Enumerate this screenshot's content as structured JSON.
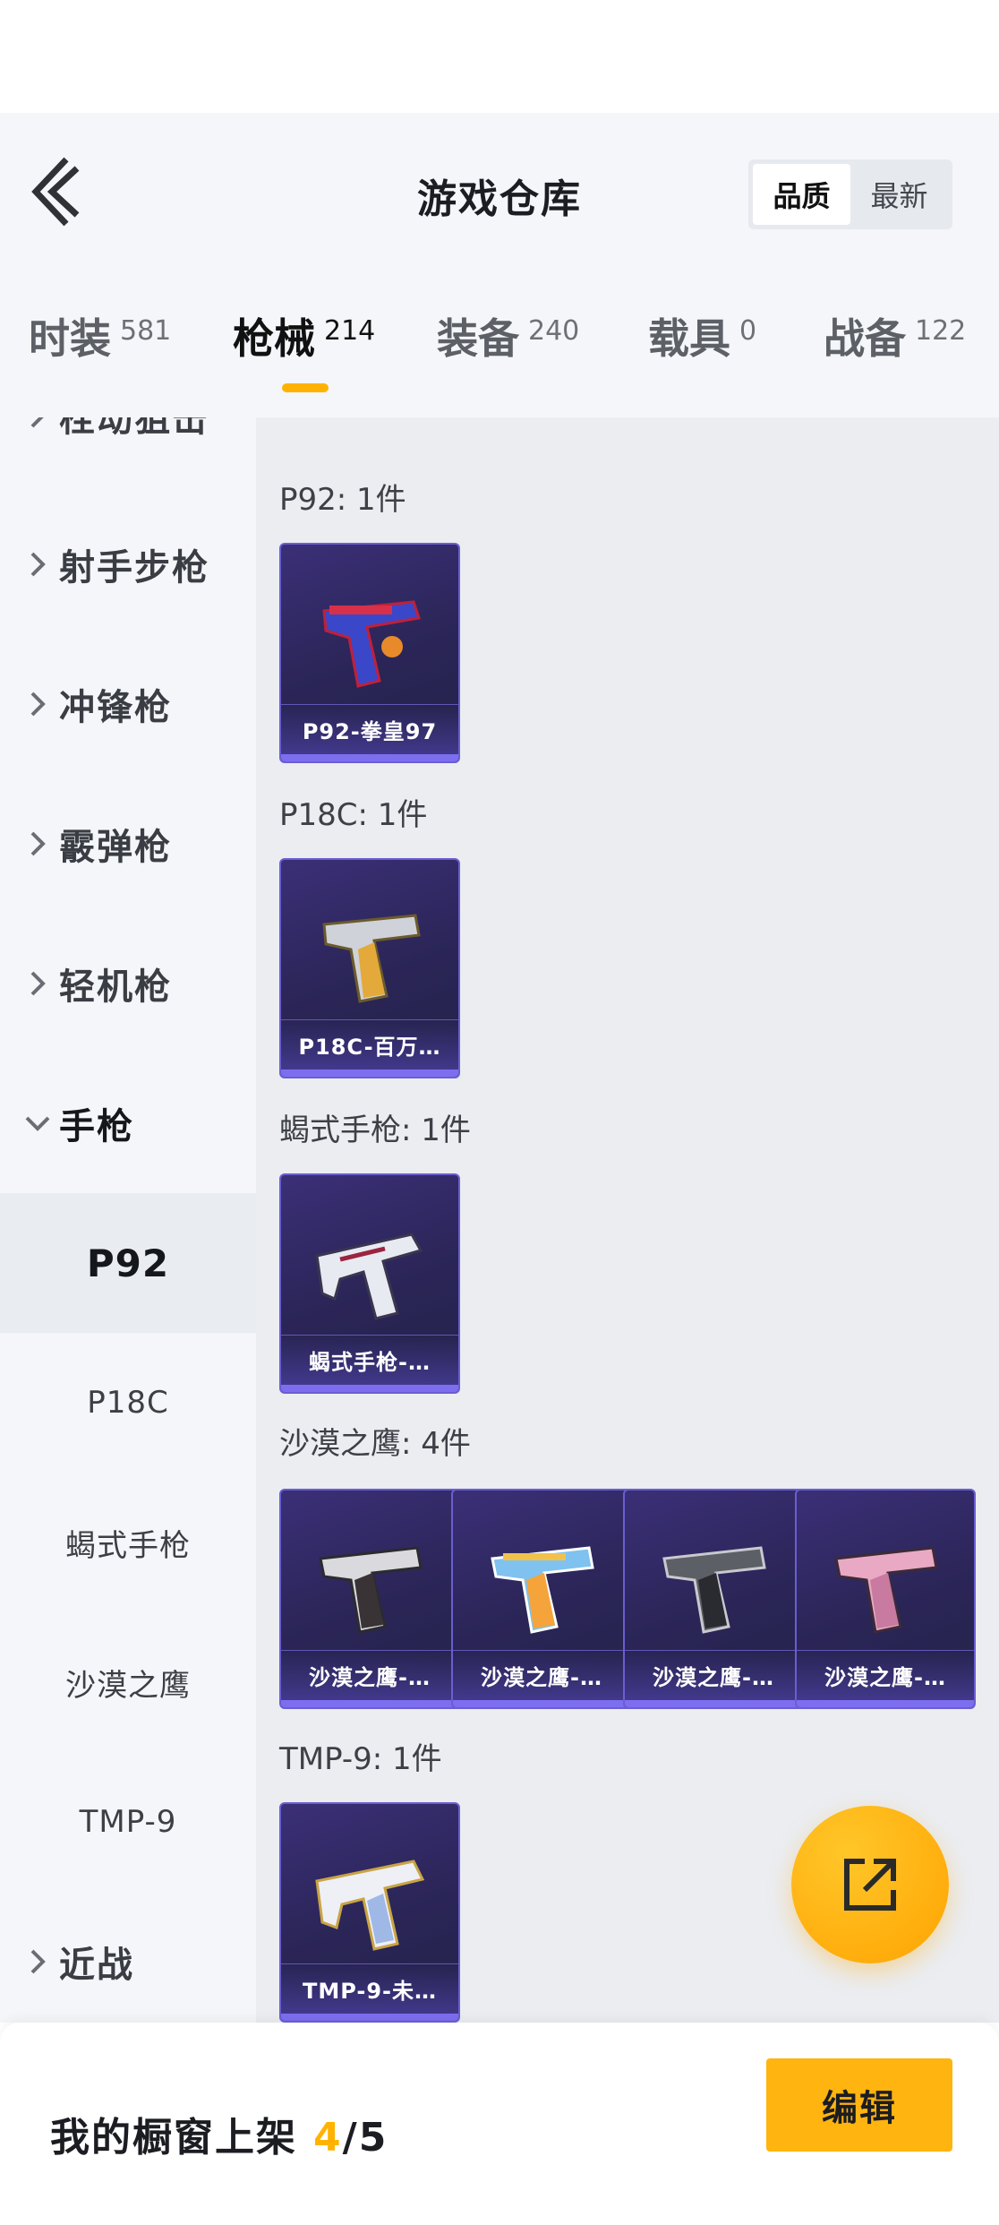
{
  "header": {
    "title": "游戏仓库",
    "sort_options": [
      "品质",
      "最新"
    ],
    "sort_active": "品质"
  },
  "tabs": [
    {
      "label": "时装",
      "count": "581"
    },
    {
      "label": "枪械",
      "count": "214"
    },
    {
      "label": "装备",
      "count": "240"
    },
    {
      "label": "载具",
      "count": "0"
    },
    {
      "label": "战备",
      "count": "122"
    }
  ],
  "active_tab": "枪械",
  "sidebar": {
    "categories_top": [
      "栓动狙击",
      "射手步枪",
      "冲锋枪",
      "霰弹枪",
      "轻机枪"
    ],
    "open_category": "手枪",
    "subcategories": [
      "P92",
      "P18C",
      "蝎式手枪",
      "沙漠之鹰",
      "TMP-9"
    ],
    "active_subcategory": "P92",
    "categories_bottom": [
      "近战"
    ]
  },
  "groups": [
    {
      "title": "P92: 1件",
      "items": [
        "P92-拳皇97"
      ]
    },
    {
      "title": "P18C: 1件",
      "items": [
        "P18C-百万…"
      ]
    },
    {
      "title": "蝎式手枪: 1件",
      "items": [
        "蝎式手枪-…"
      ]
    },
    {
      "title": "沙漠之鹰: 4件",
      "items": [
        "沙漠之鹰-…",
        "沙漠之鹰-…",
        "沙漠之鹰-…",
        "沙漠之鹰-…"
      ]
    },
    {
      "title": "TMP-9: 1件",
      "items": [
        "TMP-9-未…"
      ]
    }
  ],
  "footer": {
    "label": "我的橱窗上架",
    "current": "4",
    "total": "/5",
    "edit_label": "编辑"
  },
  "colors": {
    "accent": "#ffb300",
    "card_bg": "#2a2556",
    "card_border": "#6a5ed1"
  }
}
